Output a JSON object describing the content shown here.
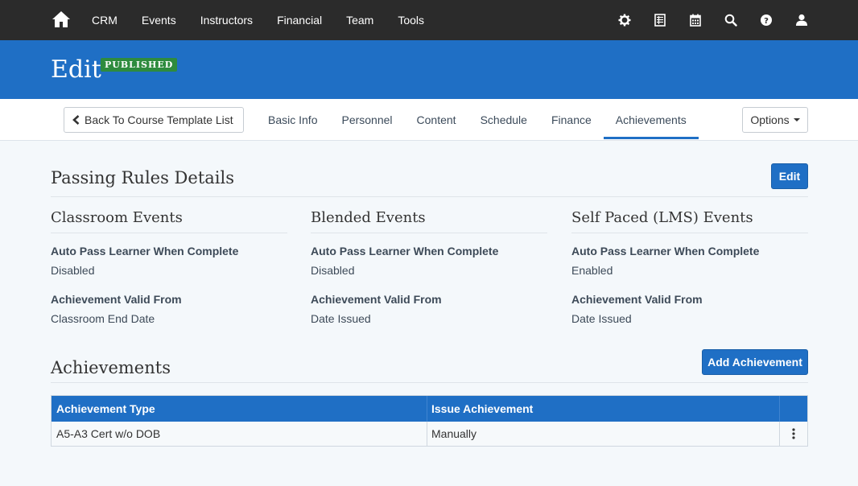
{
  "nav": {
    "items": [
      {
        "label": "CRM"
      },
      {
        "label": "Events"
      },
      {
        "label": "Instructors"
      },
      {
        "label": "Financial"
      },
      {
        "label": "Team"
      },
      {
        "label": "Tools"
      }
    ],
    "icons": [
      "gear-icon",
      "spreadsheet-icon",
      "calendar-icon",
      "search-icon",
      "help-icon",
      "user-icon"
    ]
  },
  "header": {
    "title": "Edit",
    "badge": "PUBLISHED",
    "accent_color": "#1f6fc5",
    "badge_color": "#2e8b3e"
  },
  "tabbar": {
    "back_label": "Back To Course Template List",
    "tabs": [
      {
        "label": "Basic Info"
      },
      {
        "label": "Personnel"
      },
      {
        "label": "Content"
      },
      {
        "label": "Schedule"
      },
      {
        "label": "Finance"
      },
      {
        "label": "Achievements"
      }
    ],
    "active_tab": "Achievements",
    "options_label": "Options"
  },
  "passing_rules": {
    "title": "Passing Rules Details",
    "edit_label": "Edit",
    "columns": [
      {
        "title": "Classroom Events",
        "auto_pass_label": "Auto Pass Learner When Complete",
        "auto_pass_value": "Disabled",
        "valid_from_label": "Achievement Valid From",
        "valid_from_value": "Classroom End Date"
      },
      {
        "title": "Blended Events",
        "auto_pass_label": "Auto Pass Learner When Complete",
        "auto_pass_value": "Disabled",
        "valid_from_label": "Achievement Valid From",
        "valid_from_value": "Date Issued"
      },
      {
        "title": "Self Paced (LMS) Events",
        "auto_pass_label": "Auto Pass Learner When Complete",
        "auto_pass_value": "Enabled",
        "valid_from_label": "Achievement Valid From",
        "valid_from_value": "Date Issued"
      }
    ]
  },
  "achievements": {
    "title": "Achievements",
    "add_label": "Add Achievement",
    "columns": [
      "Achievement Type",
      "Issue Achievement",
      ""
    ],
    "rows": [
      {
        "type": "A5-A3 Cert w/o DOB",
        "issue": "Manually"
      }
    ]
  }
}
